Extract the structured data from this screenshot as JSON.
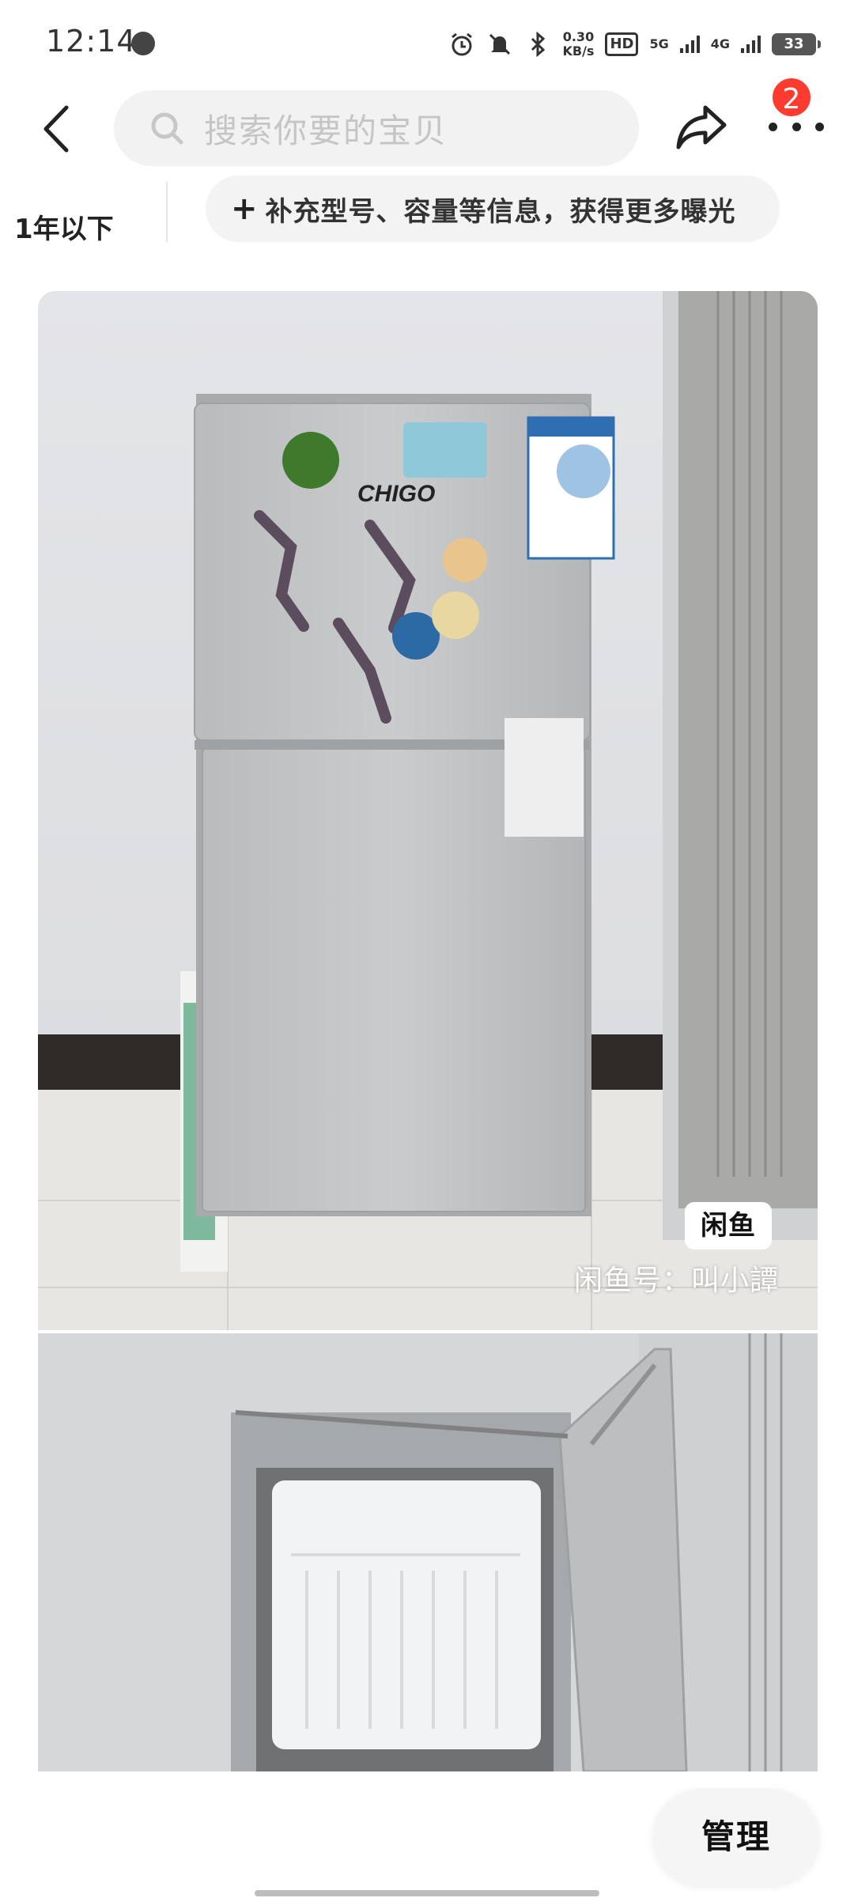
{
  "status_bar": {
    "time": "12:14",
    "speed_value": "0.30",
    "speed_unit": "KB/s",
    "hd_label": "HD",
    "net1_label": "5G",
    "net2_label": "4G",
    "battery": "33"
  },
  "nav": {
    "search_placeholder": "搜索你要的宝贝",
    "notification_count": "2"
  },
  "info": {
    "age": "1年以下",
    "hint": "补充型号、容量等信息，获得更多曝光"
  },
  "photo": {
    "brand_label": "CHIGO",
    "watermark_logo": "闲鱼",
    "watermark_text": "闲鱼号：叫小譚"
  },
  "bottom": {
    "manage_label": "管理"
  },
  "colors": {
    "badge": "#ff3b30",
    "pill_bg": "#f3f3f3",
    "search_bg": "#f2f2f2"
  }
}
